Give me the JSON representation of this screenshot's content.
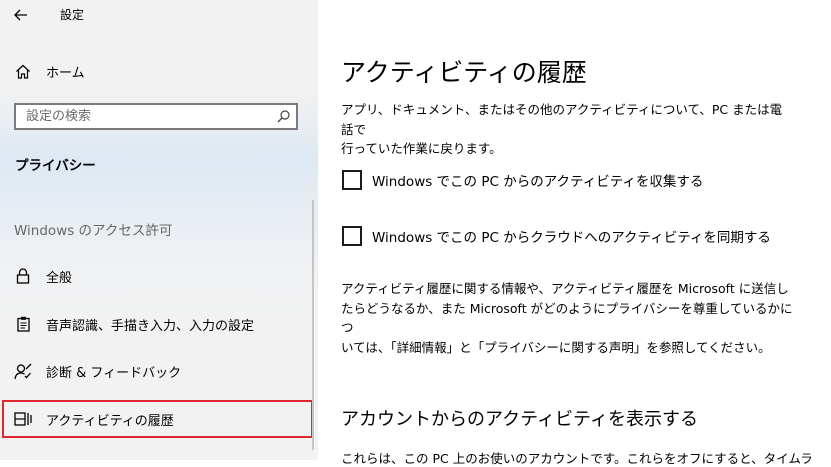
{
  "window": {
    "title": "設定"
  },
  "sidebar": {
    "home_label": "ホーム",
    "search_placeholder": "設定の検索",
    "section_title": "プライバシー",
    "group_header": "Windows のアクセス許可",
    "items": [
      {
        "label": "全般",
        "icon": "lock-icon"
      },
      {
        "label": "音声認識、手描き入力、入力の設定",
        "icon": "clipboard-icon"
      },
      {
        "label": "診断 & フィードバック",
        "icon": "person-feedback-icon"
      },
      {
        "label": "アクティビティの履歴",
        "icon": "activity-history-icon",
        "selected": true
      }
    ],
    "highlight_color": "#e0262e"
  },
  "main": {
    "title": "アクティビティの履歴",
    "description_lines": [
      "アプリ、ドキュメント、またはその他のアクティビティについて、PC または電話で",
      "行っていた作業に戻ります。"
    ],
    "checkboxes": [
      {
        "label": "Windows でこの PC からのアクティビティを収集する",
        "checked": false
      },
      {
        "label": "Windows でこの PC からクラウドへのアクティビティを同期する",
        "checked": false
      }
    ],
    "info_lines": [
      "アクティビティ履歴に関する情報や、アクティビティ履歴を Microsoft に送信し",
      "たらどうなるか、また Microsoft がどのようにプライバシーを尊重しているかにつ",
      "いては、「詳細情報」と「プライバシーに関する声明」を参照してください。"
    ],
    "account_section_title": "アカウントからのアクティビティを表示する",
    "cut_off_text": "これらは、この PC 上のお使いのアカウントです。これらをオフにすると、タイムラ"
  }
}
